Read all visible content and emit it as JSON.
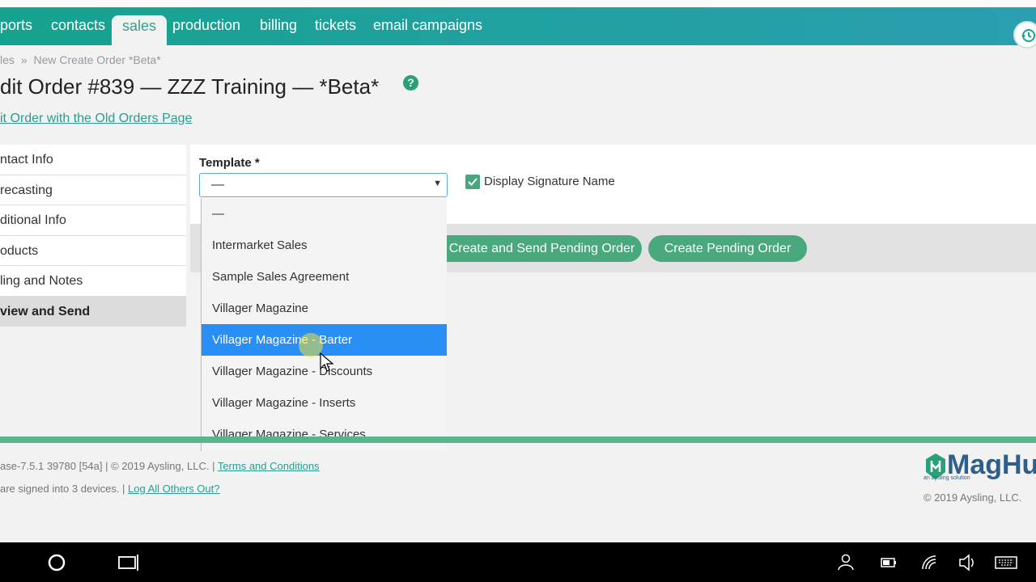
{
  "nav": {
    "items": [
      "ports",
      "contacts",
      "sales",
      "production",
      "billing",
      "tickets",
      "email campaigns"
    ],
    "active": "sales"
  },
  "breadcrumb": {
    "parent": "les",
    "separator": "»",
    "current": "New Create Order *Beta*"
  },
  "page": {
    "title": "dit Order #839 — ZZZ Training — *Beta*",
    "help": "?",
    "old_link": "it Order with the Old Orders Page"
  },
  "sidebar": {
    "items": [
      {
        "label": "ntact Info",
        "active": false
      },
      {
        "label": "recasting",
        "active": false
      },
      {
        "label": "ditional Info",
        "active": false
      },
      {
        "label": "oducts",
        "active": false
      },
      {
        "label": "ling and Notes",
        "active": false
      },
      {
        "label": "view and Send",
        "active": true
      }
    ]
  },
  "form": {
    "template_label": "Template *",
    "template_value": "—",
    "display_signature_label": "Display Signature Name",
    "display_signature_checked": true
  },
  "dropdown": {
    "options": [
      "—",
      "Intermarket Sales",
      "Sample Sales Agreement",
      "Villager Magazine",
      "Villager Magazine - Barter",
      "Villager Magazine - Discounts",
      "Villager Magazine - Inserts",
      "Villager Magazine - Services"
    ],
    "highlighted_index": 4
  },
  "actions": {
    "create_send": "Create and Send Pending Order",
    "create": "Create Pending Order"
  },
  "footer": {
    "version": "ase-7.5.1 39780 [54a] | © 2019 Aysling, LLC. | ",
    "terms": "Terms and Conditions",
    "devices": "are signed into 3 devices. | ",
    "logout": "Log All Others Out?",
    "logo": "MagHub",
    "logo_sub": "an aysling solution",
    "copyright": "© 2019 Aysling, LLC."
  },
  "colors": {
    "nav_start": "#17a28f",
    "nav_end": "#2a9fb0",
    "accent_green": "#49a97c",
    "link": "#2a9d8f",
    "selected_option": "#2a8ff5"
  }
}
